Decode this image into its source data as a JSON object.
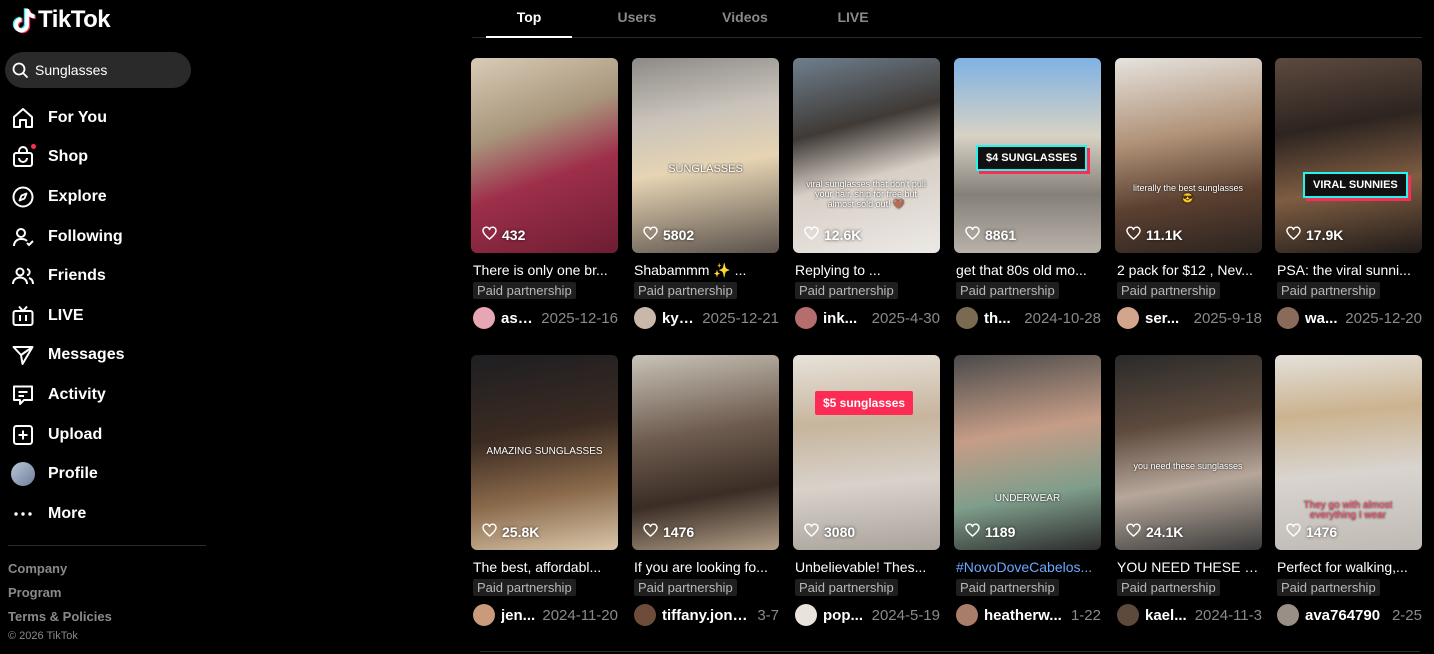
{
  "app": {
    "name": "TikTok"
  },
  "search": {
    "value": "Sunglasses",
    "placeholder": "Search"
  },
  "nav": [
    {
      "id": "for-you",
      "label": "For You",
      "icon": "home-icon"
    },
    {
      "id": "shop",
      "label": "Shop",
      "icon": "shop-icon"
    },
    {
      "id": "explore",
      "label": "Explore",
      "icon": "compass-icon"
    },
    {
      "id": "following",
      "label": "Following",
      "icon": "following-icon"
    },
    {
      "id": "friends",
      "label": "Friends",
      "icon": "friends-icon"
    },
    {
      "id": "live",
      "label": "LIVE",
      "icon": "live-tv-icon"
    },
    {
      "id": "messages",
      "label": "Messages",
      "icon": "paper-plane-icon"
    },
    {
      "id": "activity",
      "label": "Activity",
      "icon": "message-box-icon"
    },
    {
      "id": "upload",
      "label": "Upload",
      "icon": "plus-square-icon"
    },
    {
      "id": "profile",
      "label": "Profile",
      "icon": "avatar"
    },
    {
      "id": "more",
      "label": "More",
      "icon": "ellipsis-icon"
    }
  ],
  "footer": {
    "links": [
      "Company",
      "Program",
      "Terms & Policies"
    ],
    "copyright": "© 2026 TikTok"
  },
  "tabs": [
    {
      "label": "Top",
      "active": true
    },
    {
      "label": "Users",
      "active": false
    },
    {
      "label": "Videos",
      "active": false
    },
    {
      "label": "LIVE",
      "active": false
    }
  ],
  "paid_label": "Paid partnership",
  "videos": [
    {
      "likes": "432",
      "title": "There is only one br...",
      "user": "ash...",
      "date": "2025-12-16",
      "paid": true
    },
    {
      "likes": "5802",
      "title": "Shabammm ✨ ...",
      "user": "kya...",
      "date": "2025-12-21",
      "paid": true,
      "overlay": "SUNGLASSES"
    },
    {
      "likes": "12.6K",
      "title": "Replying to ...",
      "user": "ink...",
      "date": "2025-4-30",
      "paid": true,
      "overlay": "viral sunglasses that don't pull your hair, ship for free but almost sold out! 🤎"
    },
    {
      "likes": "8861",
      "title": "get that 80s old mo...",
      "user": "th...",
      "date": "2024-10-28",
      "paid": true,
      "badge": "$4 SUNGLASSES"
    },
    {
      "likes": "11.1K",
      "title": "2 pack for $12 , Nev...",
      "user": "ser...",
      "date": "2025-9-18",
      "paid": true,
      "overlay": "literally the best sunglasses 😎"
    },
    {
      "likes": "17.9K",
      "title": "PSA: the viral sunni...",
      "user": "wa...",
      "date": "2025-12-20",
      "paid": true,
      "badge": "VIRAL SUNNIES"
    },
    {
      "likes": "25.8K",
      "title": "The best, affordabl...",
      "user": "jen...",
      "date": "2024-11-20",
      "paid": true,
      "overlay": "AMAZING SUNGLASSES"
    },
    {
      "likes": "1476",
      "title": "If you are looking fo...",
      "user": "tiffany.jone...",
      "date": "3-7",
      "paid": true
    },
    {
      "likes": "3080",
      "title": "Unbelievable! Thes...",
      "user": "pop...",
      "date": "2024-5-19",
      "paid": true,
      "badge_red": "$5 sunglasses"
    },
    {
      "likes": "1189",
      "title": "#NovoDoveCabelos...",
      "user": "heatherw...",
      "date": "1-22",
      "paid": true,
      "overlay": "UNDERWEAR",
      "title_link": true
    },
    {
      "likes": "24.1K",
      "title": "YOU NEED THESE S...",
      "user": "kael...",
      "date": "2024-11-3",
      "paid": true,
      "overlay": "you need these sunglasses"
    },
    {
      "likes": "1476",
      "title": "Perfect for walking,...",
      "user": "ava764790",
      "date": "2-25",
      "paid": true,
      "overlay": "They go with almost everything I wear"
    }
  ],
  "colors": {
    "accent": "#fe2c55",
    "cyan": "#25f4ee",
    "bg": "#000000",
    "muted": "#8a8a8a"
  }
}
